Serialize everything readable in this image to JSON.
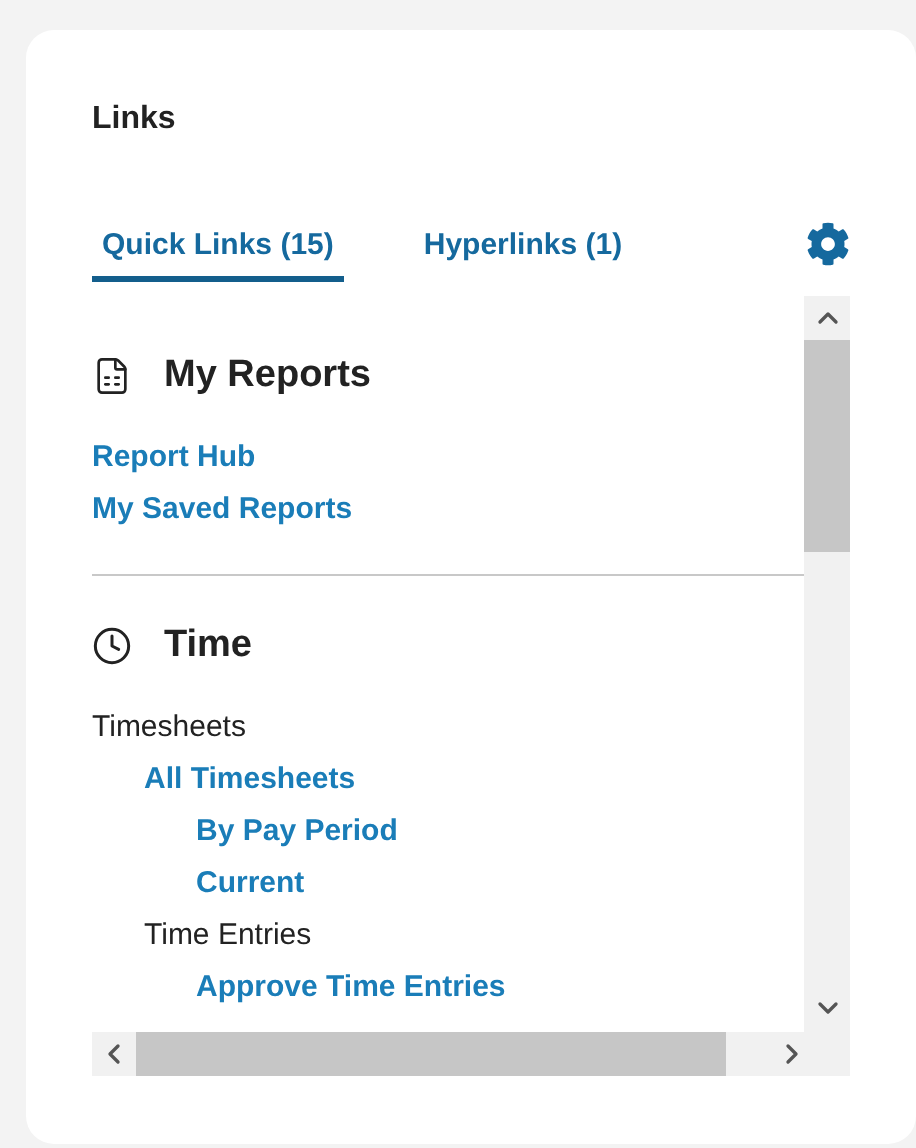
{
  "card": {
    "title": "Links"
  },
  "tabs": [
    {
      "label": "Quick Links (15)",
      "selected": true
    },
    {
      "label": "Hyperlinks (1)",
      "selected": false
    }
  ],
  "sections": [
    {
      "title": "My Reports",
      "kind": "report",
      "items": [
        {
          "kind": "link",
          "label": "Report Hub"
        },
        {
          "kind": "link",
          "label": "My Saved Reports"
        }
      ]
    },
    {
      "title": "Time",
      "kind": "clock",
      "items": [
        {
          "kind": "label",
          "label": "Timesheets",
          "children": [
            {
              "kind": "link",
              "label": "All Timesheets",
              "children": [
                {
                  "kind": "link",
                  "label": "By Pay Period"
                },
                {
                  "kind": "link",
                  "label": "Current"
                }
              ]
            },
            {
              "kind": "label",
              "label": "Time Entries",
              "children": [
                {
                  "kind": "link",
                  "label": "Approve Time Entries"
                }
              ]
            }
          ]
        }
      ]
    }
  ]
}
